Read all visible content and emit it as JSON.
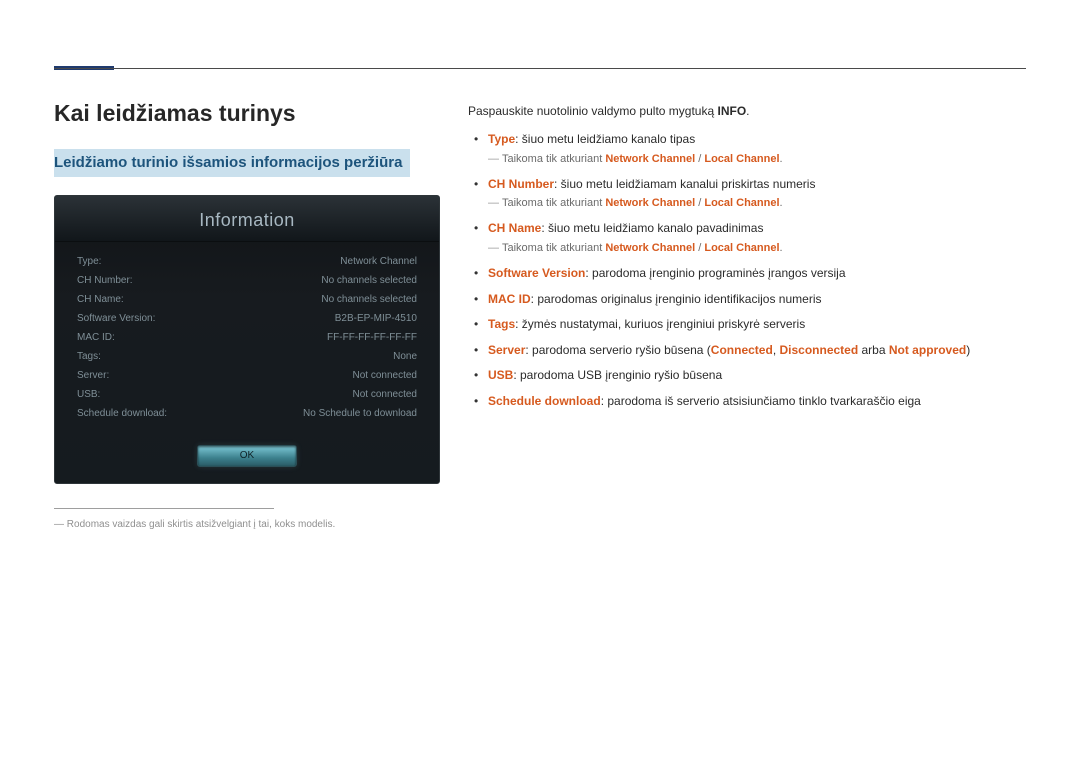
{
  "header": {
    "title": "Kai leidžiamas turinys"
  },
  "subheader": {
    "title": "Leidžiamo turinio išsamios informacijos peržiūra"
  },
  "info_panel": {
    "title": "Information",
    "rows": [
      {
        "label": "Type:",
        "value": "Network Channel"
      },
      {
        "label": "CH Number:",
        "value": "No channels selected"
      },
      {
        "label": "CH Name:",
        "value": "No channels selected"
      },
      {
        "label": "Software Version:",
        "value": "B2B-EP-MIP-4510"
      },
      {
        "label": "MAC ID:",
        "value": "FF-FF-FF-FF-FF-FF"
      },
      {
        "label": "Tags:",
        "value": "None"
      },
      {
        "label": "Server:",
        "value": "Not connected"
      },
      {
        "label": "USB:",
        "value": "Not connected"
      },
      {
        "label": "Schedule download:",
        "value": "No Schedule to download"
      }
    ],
    "ok": "OK"
  },
  "footnote": "Rodomas vaizdas gali skirtis atsižvelgiant į tai, koks modelis.",
  "right": {
    "intro_a": "Paspauskite nuotolinio valdymo pulto mygtuką ",
    "intro_b": "INFO",
    "intro_c": ".",
    "sub_prefix": "Taikoma tik atkuriant ",
    "sub_nc": "Network Channel",
    "sub_sep": " / ",
    "sub_lc": "Local Channel",
    "sub_end": ".",
    "items": {
      "type_k": "Type",
      "type_v": ": šiuo metu leidžiamo kanalo tipas",
      "chnum_k": "CH Number",
      "chnum_v": ": šiuo metu leidžiamam kanalui priskirtas numeris",
      "chname_k": "CH Name",
      "chname_v": ": šiuo metu leidžiamo kanalo pavadinimas",
      "sw_k": "Software Version",
      "sw_v": ": parodoma įrenginio programinės įrangos versija",
      "mac_k": "MAC ID",
      "mac_v": ": parodomas originalus įrenginio identifikacijos numeris",
      "tags_k": "Tags",
      "tags_v": ": žymės nustatymai, kuriuos įrenginiui priskyrė serveris",
      "server_k": "Server",
      "server_v_a": ": parodoma serverio ryšio būsena (",
      "server_conn": "Connected",
      "server_comma1": ", ",
      "server_disc": "Disconnected",
      "server_mid": " arba ",
      "server_na": "Not approved",
      "server_v_b": ")",
      "usb_k": "USB",
      "usb_v": ": parodoma USB įrenginio ryšio būsena",
      "sched_k": "Schedule download",
      "sched_v": ": parodoma iš serverio atsisiunčiamo tinklo tvarkaraščio eiga"
    }
  }
}
